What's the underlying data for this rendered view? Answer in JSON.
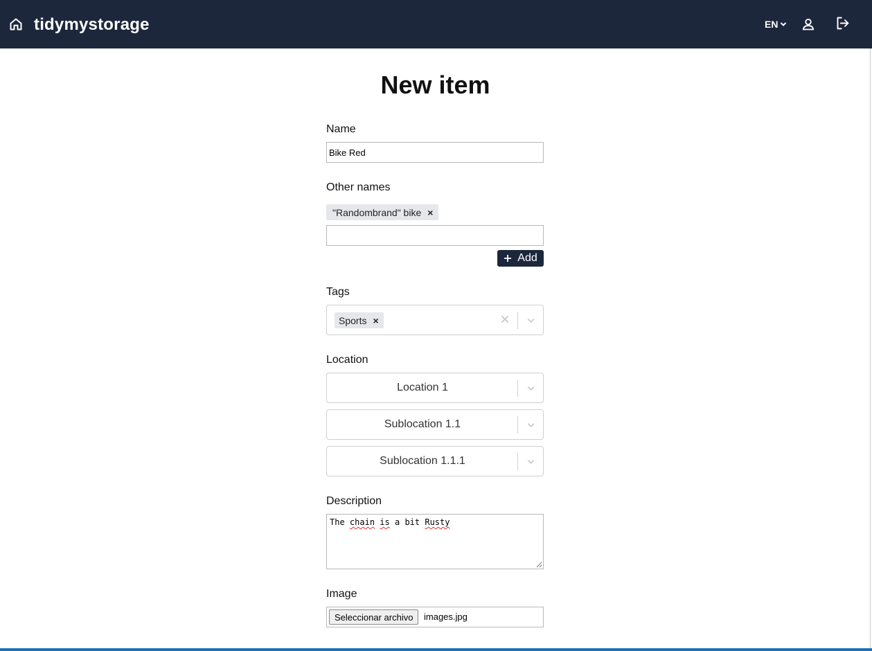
{
  "header": {
    "brand": "tidymystorage",
    "language": "EN",
    "icons": {
      "home": "home-icon",
      "user": "user-icon",
      "logout": "logout-icon"
    }
  },
  "page": {
    "title": "New item"
  },
  "form": {
    "name": {
      "label": "Name",
      "value": "Bike Red"
    },
    "other_names": {
      "label": "Other names",
      "chips": [
        "\"Randombrand\" bike"
      ],
      "input_value": "",
      "add_label": "Add"
    },
    "tags": {
      "label": "Tags",
      "selected": [
        "Sports"
      ]
    },
    "location": {
      "label": "Location",
      "levels": [
        "Location 1",
        "Sublocation 1.1",
        "Sublocation 1.1.1"
      ]
    },
    "description": {
      "label": "Description",
      "words": [
        "The",
        "chain",
        "is",
        "a",
        "bit",
        "Rusty"
      ]
    },
    "image": {
      "label": "Image",
      "button_label": "Seleccionar archivo",
      "file_name": "images.jpg"
    }
  },
  "colors": {
    "header_bg": "#1d273c",
    "button_bg": "#1d273c",
    "chip_bg": "#e5e7eb",
    "status_bar": "#1f6fb5"
  }
}
